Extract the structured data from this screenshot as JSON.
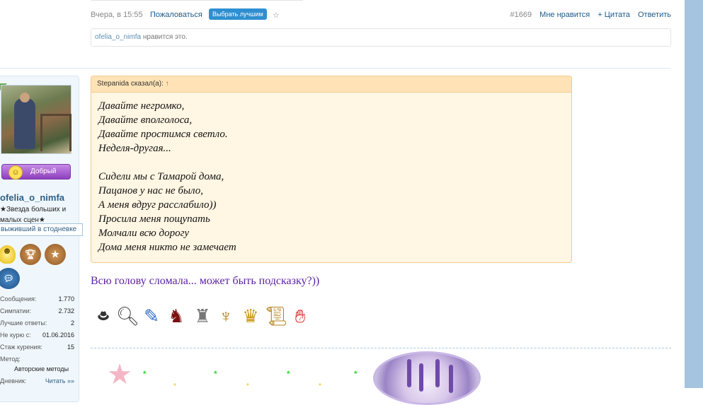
{
  "post_meta": {
    "date": "Вчера, в 15:55",
    "report": "Пожаловаться",
    "choose_best": "Выбрать лучшим",
    "star_icon": "star-outline-icon",
    "post_number": "#1669",
    "like": "Мне нравится",
    "quote": "+ Цитата",
    "reply": "Ответить"
  },
  "likes_bar": {
    "user": "ofelia_o_nimfa",
    "text": "нравится это."
  },
  "user": {
    "mood": "Добрый",
    "name": "ofelia_o_nimfa",
    "title_line1": "★Звезда больших и",
    "title_line2": "малых сцен★",
    "status": "выживший в стодневке",
    "stats": [
      {
        "key": "Сообщения:",
        "value": "1.770"
      },
      {
        "key": "Симпатии:",
        "value": "2.732"
      },
      {
        "key": "Лучшие ответы:",
        "value": "2"
      },
      {
        "key": "Не курю с:",
        "value": "01.06.2016"
      },
      {
        "key": "Стаж курения:",
        "value": "15"
      },
      {
        "key": "Метод:",
        "value": ""
      },
      {
        "key": "",
        "value": "Авторские методы"
      },
      {
        "key": "Дневник:",
        "value": "Читать »»"
      }
    ]
  },
  "quote": {
    "author": "Stepanida сказал(а):",
    "arrow": "↑",
    "lines": [
      "Давайте негромко,",
      "Давайте вполголоса,",
      "Давайте простимся светло.",
      "Неделя-другая...",
      "",
      "Сидели мы с Тамарой дома,",
      "Пацанов у нас не было,",
      "А меня вдруг расслабило))",
      "Просила меня пощупать",
      "Молчали всю дорогу",
      "Дома меня никто не замечает"
    ]
  },
  "message": "Всю голову сломала... может быть подсказку?))",
  "icons": [
    "gentleman-icon",
    "magnifier-icon",
    "pencil-icon",
    "cat-mask-icon",
    "statue-icon",
    "lyre-icon",
    "trophy-icon",
    "scroll-icon",
    "stop-hand-icon"
  ],
  "colors": {
    "link": "#1d5b8a",
    "message": "#5a1fa0",
    "quote_bg": "#fff6e3",
    "quote_border": "#f2c98e",
    "scrollbar": "#a5c4df"
  }
}
